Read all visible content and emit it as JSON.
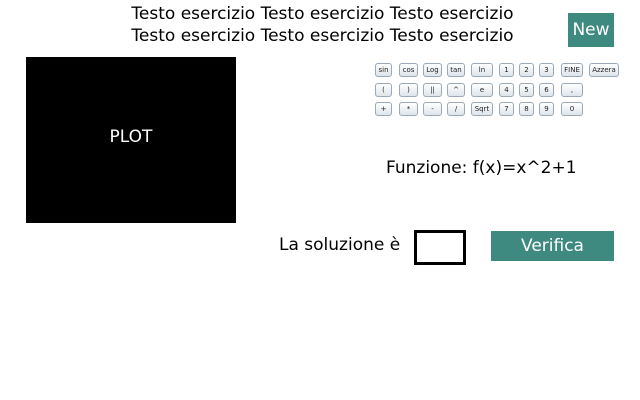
{
  "exercise": {
    "lines": [
      "Testo esercizio Testo esercizio Testo esercizio",
      "Testo esercizio Testo esercizio Testo esercizio"
    ]
  },
  "new_button": {
    "label": "New"
  },
  "plot": {
    "label": "PLOT"
  },
  "keypad": {
    "rows": [
      [
        "sin",
        "cos",
        "Log",
        "tan",
        "ln",
        "1",
        "2",
        "3",
        "FINE",
        "Azzera"
      ],
      [
        "(",
        ")",
        "||",
        "^",
        "e",
        "4",
        "5",
        "6",
        ","
      ],
      [
        "+",
        "*",
        "-",
        "/",
        "Sqrt",
        "7",
        "8",
        "9",
        "0"
      ]
    ]
  },
  "function": {
    "text": "Funzione: f(x)=x^2+1"
  },
  "solution": {
    "label": "La soluzione è",
    "value": ""
  },
  "verify_button": {
    "label": "Verifica"
  },
  "colors": {
    "accent": "#3f8a80",
    "plot_bg": "#000000"
  }
}
